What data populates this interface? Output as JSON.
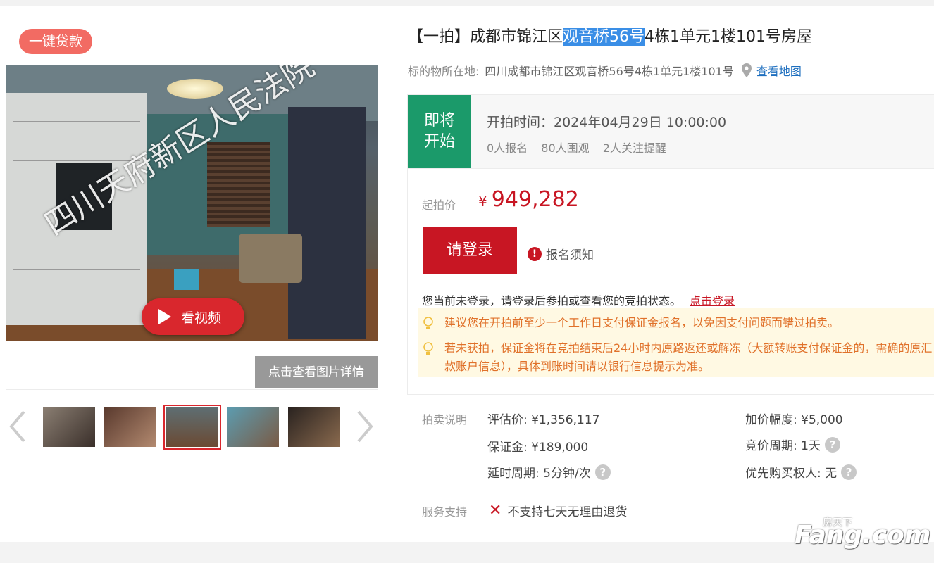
{
  "gallery": {
    "loan_badge": "一键贷款",
    "watermark": "四川天府新区人民法院",
    "video_button": "看视频",
    "details_button": "点击查看图片详情",
    "thumbnails": [
      "thumb-1",
      "thumb-2",
      "thumb-3",
      "thumb-4",
      "thumb-5"
    ],
    "active_thumbnail": 3
  },
  "listing": {
    "title_prefix": "【一拍】成都市锦江区",
    "title_highlight": "观音桥56号",
    "title_suffix": "4栋1单元1楼101号房屋",
    "location_label": "标的物所在地:",
    "location_value": "四川成都市锦江区观音桥56号4栋1单元1楼101号",
    "map_link": "查看地图"
  },
  "status": {
    "tag_line1": "即将",
    "tag_line2": "开始",
    "start_time": "开拍时间：2024年04月29日 10:00:00",
    "registered": "0人报名",
    "watching": "80人围观",
    "followers": "2人关注提醒",
    "tag_color": "#1b9a6a"
  },
  "price": {
    "label": "起拍价",
    "currency": "¥",
    "value": "949,282",
    "login_button": "请登录",
    "notice_link": "报名须知",
    "login_tip": "您当前未登录，请登录后参拍或查看您的竞拍状态。",
    "login_link": "点击登录",
    "tip1": "建议您在开拍前至少一个工作日支付保证金报名，以免因支付问题而错过拍卖。",
    "tip2": "若未获拍，保证金将在竞拍结束后24小时内原路返还或解冻（大额转账支付保证金的，需确的原汇款账户信息），具体到账时间请以银行信息提示为准。",
    "accent_color": "#c81623"
  },
  "auction_info": {
    "label": "拍卖说明",
    "appraisal": "评估价: ¥1,356,117",
    "increment": "加价幅度: ¥5,000",
    "deposit": "保证金: ¥189,000",
    "cycle": "竞价周期: 1天",
    "delay": "延时周期: 5分钟/次",
    "priority": "优先购买权人: 无"
  },
  "service": {
    "label": "服务支持",
    "item": "不支持七天无理由退货"
  },
  "logo": {
    "small": "房天下",
    "big": "Fang.com"
  }
}
